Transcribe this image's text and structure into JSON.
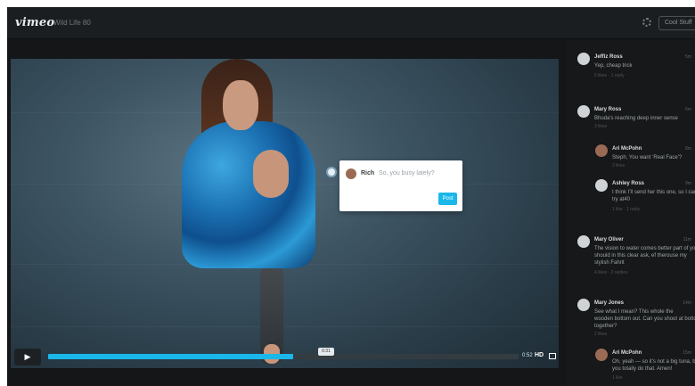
{
  "app": {
    "logo": "vimeo",
    "title": "Wild Life 80"
  },
  "topbar": {
    "button_label": "Cool Stuff",
    "settings_icon": "gear-icon"
  },
  "player": {
    "annotation": {
      "author": "Rich",
      "placeholder": "So, you busy lately?",
      "post_label": "Post"
    },
    "controls": {
      "play_icon": "▶",
      "progress_fraction": 0.52,
      "playhead_label": "0:31",
      "time_label": "0:52",
      "hd_label": "HD"
    }
  },
  "sidebar": {
    "comments": [
      {
        "name": "Jeffiz Ross",
        "time": "5m",
        "text": "Yep, cheap trick",
        "meta": "5 likes · 1 reply"
      },
      {
        "name": "Mary Ross",
        "time": "6m",
        "text": "Bhuda's reaching deep inner sense",
        "meta": "3 likes"
      },
      {
        "name": "Ari McPohn",
        "time": "8m",
        "text": "Steph, You want ‘Real Face’?",
        "meta": "2 likes"
      },
      {
        "name": "Ashley Ross",
        "time": "9m",
        "text": "I think I'll send her this one, so I can",
        "text2": "try at40",
        "meta": "1 like · 1 reply"
      },
      {
        "name": "Mary Oliver",
        "time": "11m",
        "text": "The vision to water comes better part of you",
        "text2": "should in this clear ask, ef therouse my",
        "text3": "stylish Fahrit",
        "meta": "4 likes · 2 replies"
      },
      {
        "name": "Mary Jones",
        "time": "14m",
        "text": "See what I mean? This whole the",
        "text2": "wooden bottom out. Can you shoot at bottom",
        "text3": "together?",
        "meta": "2 likes"
      },
      {
        "name": "Ari McPohn",
        "time": "15m",
        "text": "Oh, yeah — so it's not a big tuna, but",
        "text2": "you totally do that. Amen!",
        "meta": "1 like"
      }
    ]
  }
}
